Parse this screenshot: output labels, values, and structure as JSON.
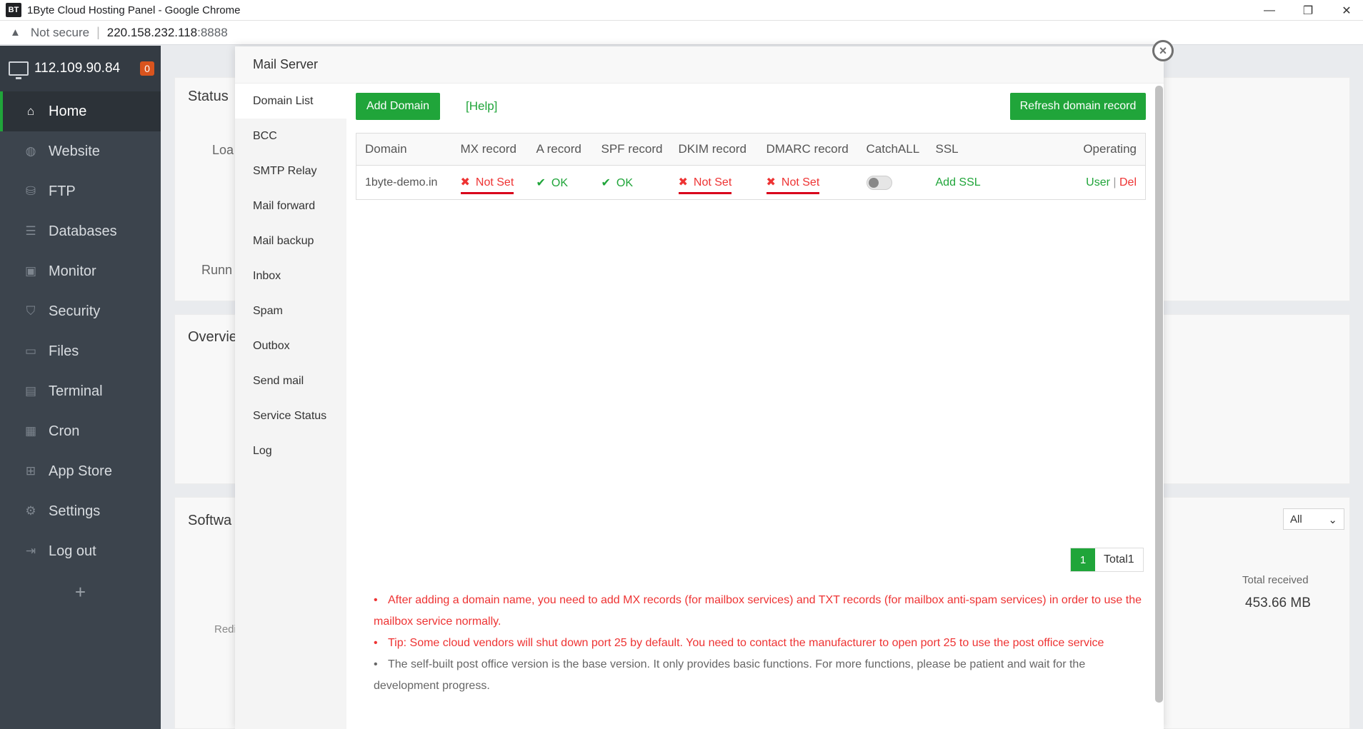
{
  "browser": {
    "app_icon": "BT",
    "title": "1Byte Cloud Hosting Panel - Google Chrome",
    "security_label": "Not secure",
    "url_host": "220.158.232.118",
    "url_port": ":8888",
    "minimize": "—",
    "restore": "❐",
    "close": "✕"
  },
  "sidebar": {
    "host_ip": "112.109.90.84",
    "badge": "0",
    "items": [
      {
        "label": "Home",
        "icon": "home-icon",
        "glyph": "⌂"
      },
      {
        "label": "Website",
        "icon": "globe-icon",
        "glyph": "◍"
      },
      {
        "label": "FTP",
        "icon": "ftp-icon",
        "glyph": "⛁"
      },
      {
        "label": "Databases",
        "icon": "database-icon",
        "glyph": "☰"
      },
      {
        "label": "Monitor",
        "icon": "monitor-icon",
        "glyph": "▣"
      },
      {
        "label": "Security",
        "icon": "shield-icon",
        "glyph": "⛉"
      },
      {
        "label": "Files",
        "icon": "folder-icon",
        "glyph": "▭"
      },
      {
        "label": "Terminal",
        "icon": "terminal-icon",
        "glyph": "▤"
      },
      {
        "label": "Cron",
        "icon": "calendar-icon",
        "glyph": "▦"
      },
      {
        "label": "App Store",
        "icon": "grid-icon",
        "glyph": "⊞"
      },
      {
        "label": "Settings",
        "icon": "gear-icon",
        "glyph": "⚙"
      },
      {
        "label": "Log out",
        "icon": "logout-icon",
        "glyph": "⇥"
      }
    ],
    "add": "+"
  },
  "background": {
    "status": "Status",
    "load": "Loa",
    "running": "Runn",
    "overview": "Overvie",
    "software": "Softwa",
    "redis": "Redi",
    "total_received_label": "Total received",
    "total_received_value": "453.66 MB",
    "select_value": "All"
  },
  "modal": {
    "title": "Mail Server",
    "close": "×",
    "nav": [
      "Domain List",
      "BCC",
      "SMTP Relay",
      "Mail forward",
      "Mail backup",
      "Inbox",
      "Spam",
      "Outbox",
      "Send mail",
      "Service Status",
      "Log"
    ],
    "add_domain": "Add Domain",
    "help": "[Help]",
    "refresh": "Refresh domain record",
    "table": {
      "headers": [
        "Domain",
        "MX record",
        "A record",
        "SPF record",
        "DKIM record",
        "DMARC record",
        "CatchALL",
        "SSL",
        "Operating"
      ],
      "row": {
        "domain": "1byte-demo.in",
        "mx": "Not Set",
        "a": "OK",
        "spf": "OK",
        "dkim": "Not Set",
        "dmarc": "Not Set",
        "catchall": false,
        "ssl": "Add SSL",
        "op_user": "User",
        "op_sep": "|",
        "op_del": "Del"
      }
    },
    "pager": {
      "page": "1",
      "total": "Total1"
    },
    "tips": [
      {
        "text": "After adding a domain name, you need to add MX records (for mailbox services) and TXT records (for mailbox anti-spam services) in order to use the mailbox service normally.",
        "color": "#e33"
      },
      {
        "text": "Tip: Some cloud vendors will shut down port 25 by default. You need to contact the manufacturer to open port 25 to use the post office service",
        "color": "#e33"
      },
      {
        "text": "The self-built post office version is the base version. It only provides basic functions. For more functions, please be patient and wait for the development progress.",
        "color": "#666"
      }
    ]
  },
  "colors": {
    "accent": "#20a53a",
    "danger": "#e33",
    "sidebar": "#3c444d"
  }
}
